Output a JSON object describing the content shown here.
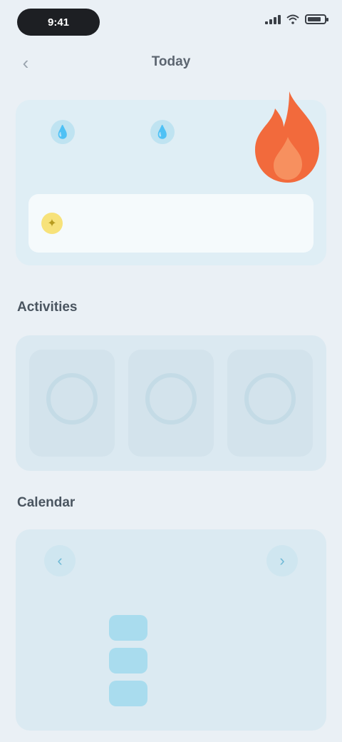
{
  "status_bar": {
    "time": "9:41"
  },
  "header": {
    "title": "Today"
  },
  "summary": {
    "stats": [
      {
        "icon": "drop-icon",
        "value": "",
        "label": ""
      },
      {
        "icon": "drop-icon",
        "value": "",
        "label": ""
      }
    ],
    "tip_text": ""
  },
  "sections": {
    "activity_title": "Activities",
    "calendar_title": "Calendar"
  },
  "activities": [
    {
      "value": "",
      "label": ""
    },
    {
      "value": "",
      "label": ""
    },
    {
      "value": "",
      "label": ""
    }
  ],
  "calendar": {
    "month_label": "",
    "rows": [
      [
        "",
        "",
        "",
        "",
        "",
        "",
        ""
      ],
      [
        "",
        "",
        "",
        "",
        "",
        "",
        ""
      ],
      [
        "",
        "",
        "",
        "",
        "",
        "",
        ""
      ]
    ]
  },
  "colors": {
    "accent": "#3fb1d6",
    "flame": "#f26a3c",
    "background": "#eaf0f5"
  }
}
